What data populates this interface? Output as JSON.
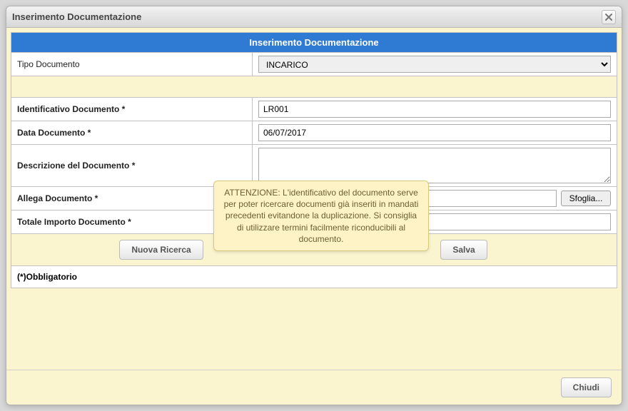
{
  "dialog": {
    "title": "Inserimento Documentazione",
    "panel_title": "Inserimento Documentazione"
  },
  "fields": {
    "tipo_documento": {
      "label": "Tipo Documento",
      "value": "INCARICO"
    },
    "identificativo": {
      "label": "Identificativo Documento *",
      "value": "LR001"
    },
    "data_documento": {
      "label": "Data Documento *",
      "value": "06/07/2017"
    },
    "descrizione": {
      "label": "Descrizione del Documento *",
      "value": ""
    },
    "allega": {
      "label": "Allega Documento *",
      "file_button": "Sfoglia..."
    },
    "totale": {
      "label": "Totale Importo Documento *",
      "value": ""
    }
  },
  "buttons": {
    "nuova_ricerca": "Nuova Ricerca",
    "salva": "Salva",
    "chiudi": "Chiudi"
  },
  "footnote": "(*)Obbligatorio",
  "tooltip": "ATTENZIONE: L'identificativo del documento serve per poter ricercare documenti già inseriti in mandati precedenti evitandone la duplicazione. Si consiglia di utilizzare termini facilmente riconducibili al documento."
}
